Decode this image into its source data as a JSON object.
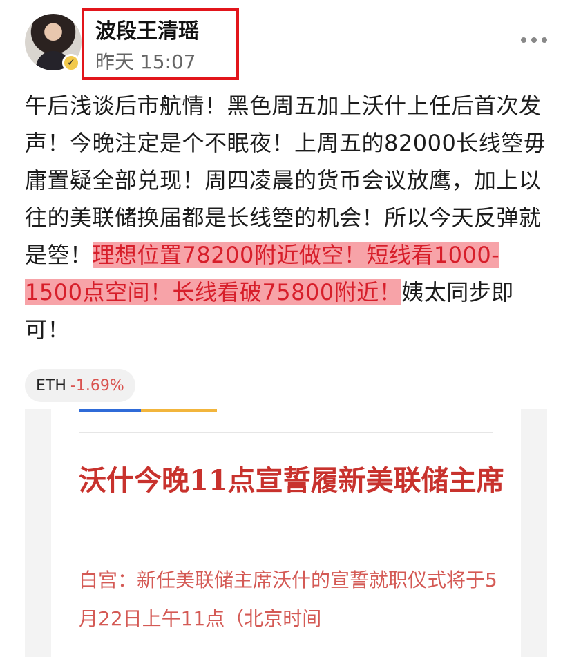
{
  "header": {
    "username": "波段王清瑶",
    "timestamp": "昨天 15:07",
    "verified_icon": "check-badge-icon",
    "more_icon": "ellipsis-icon"
  },
  "post": {
    "text_normal_1": "午后浅谈后市航情！黑色周五加上沃什上任后首次发声！今晚注定是个不眠夜！上周五的82000长线箜毋庸置疑全部兑现！周四凌晨的货币会议放鹰，加上以往的美联储换届都是长线箜的机会！所以今天反弹就是箜！",
    "text_highlight": "理想位置78200附近做空！短线看1000-1500点空间！长线看破75800附近！",
    "text_normal_2": "姨太同步即可！",
    "highlight_color": "#f7a3a8"
  },
  "ticker": {
    "symbol": "ETH",
    "change": "-1.69%",
    "change_color": "#d9534f"
  },
  "article": {
    "title": "沃什今晚11点宣誓履新美联储主席",
    "body": "白宫：新任美联储主席沃什的宣誓就职仪式将于5月22日上午11点（北京时间"
  }
}
